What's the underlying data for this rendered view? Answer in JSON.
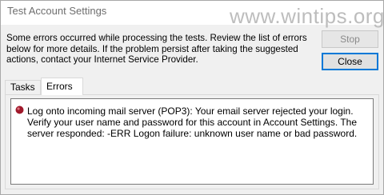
{
  "window": {
    "title": "Test Account Settings",
    "watermark": "www.wintips.org"
  },
  "message": "Some errors occurred while processing the tests. Review the list of errors below for more details. If the problem persist after taking the suggested actions, contact your Internet Service Provider.",
  "buttons": {
    "stop": "Stop",
    "close": "Close"
  },
  "tabs": [
    {
      "label": "Tasks",
      "selected": false
    },
    {
      "label": "Errors",
      "selected": true
    }
  ],
  "errors": [
    {
      "icon": "error-icon",
      "text": "Log onto incoming mail server (POP3): Your email server rejected your login. Verify your user name and password for this account in Account Settings.  The server responded: -ERR Logon failure: unknown user name or bad password."
    }
  ],
  "colors": {
    "error_icon": "#a0192b",
    "focus_border": "#0078d7"
  }
}
